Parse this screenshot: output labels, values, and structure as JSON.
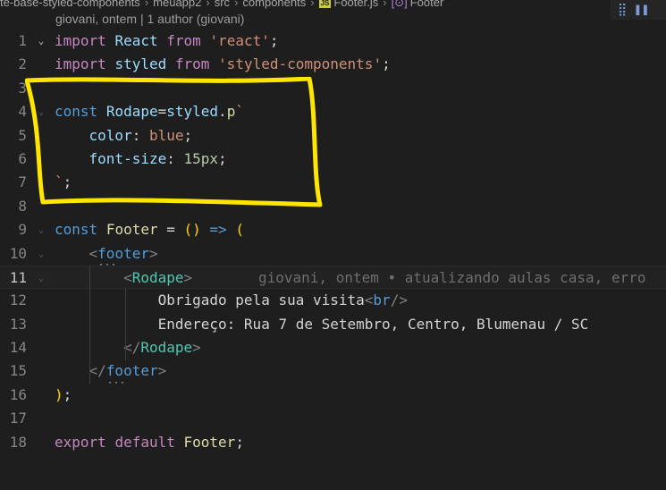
{
  "breadcrumb": {
    "parts": [
      "te-base-styled-components",
      "meuapp2",
      "src",
      "components",
      "Footer.js",
      "Footer"
    ],
    "js_badge": "JS",
    "symbol_badge": "[⊙]"
  },
  "blame_header": "giovani, ontem | 1 author (giovani)",
  "toolbar": {
    "icons": [
      "split-editor-icon",
      "pause-icon"
    ]
  },
  "inline_blame": "giovani, ontem • atualizando aulas casa, erro",
  "lines": [
    {
      "n": "1",
      "tokens": [
        [
          "imp",
          "import"
        ],
        [
          "text",
          " "
        ],
        [
          "var",
          "React"
        ],
        [
          "text",
          " "
        ],
        [
          "imp",
          "from"
        ],
        [
          "text",
          " "
        ],
        [
          "str",
          "'react'"
        ],
        [
          "text",
          ";"
        ]
      ]
    },
    {
      "n": "2",
      "tokens": [
        [
          "imp",
          "import"
        ],
        [
          "text",
          " "
        ],
        [
          "var",
          "styled"
        ],
        [
          "text",
          " "
        ],
        [
          "imp",
          "from"
        ],
        [
          "text",
          " "
        ],
        [
          "str",
          "'styled-components'"
        ],
        [
          "text",
          ";"
        ]
      ]
    },
    {
      "n": "3",
      "tokens": []
    },
    {
      "n": "4",
      "tokens": [
        [
          "kw",
          "const"
        ],
        [
          "text",
          " "
        ],
        [
          "var",
          "Rodape"
        ],
        [
          "text",
          "="
        ],
        [
          "var",
          "styled"
        ],
        [
          "text",
          "."
        ],
        [
          "fn",
          "p"
        ],
        [
          "str",
          "`"
        ]
      ]
    },
    {
      "n": "5",
      "tokens": [
        [
          "text",
          "    "
        ],
        [
          "prop",
          "color"
        ],
        [
          "text",
          ": "
        ],
        [
          "str",
          "blue"
        ],
        [
          "text",
          ";"
        ]
      ]
    },
    {
      "n": "6",
      "tokens": [
        [
          "text",
          "    "
        ],
        [
          "prop",
          "font-size"
        ],
        [
          "text",
          ": "
        ],
        [
          "num",
          "15px"
        ],
        [
          "text",
          ";"
        ]
      ]
    },
    {
      "n": "7",
      "tokens": [
        [
          "str",
          "`"
        ],
        [
          "text",
          ";"
        ]
      ]
    },
    {
      "n": "8",
      "tokens": []
    },
    {
      "n": "9",
      "tokens": [
        [
          "kw",
          "const"
        ],
        [
          "text",
          " "
        ],
        [
          "fn",
          "Footer"
        ],
        [
          "text",
          " = "
        ],
        [
          "brace",
          "()"
        ],
        [
          "text",
          " "
        ],
        [
          "kw",
          "=>"
        ],
        [
          "text",
          " "
        ],
        [
          "brace",
          "("
        ]
      ]
    },
    {
      "n": "10",
      "tokens": [
        [
          "text",
          "    "
        ],
        [
          "punct",
          "<"
        ],
        [
          "tag",
          "footer"
        ],
        [
          "punct",
          ">"
        ]
      ]
    },
    {
      "n": "11",
      "tokens": [
        [
          "text",
          "        "
        ],
        [
          "punct",
          "<"
        ],
        [
          "comp",
          "Rodape"
        ],
        [
          "punct",
          ">"
        ]
      ]
    },
    {
      "n": "12",
      "tokens": [
        [
          "text",
          "            "
        ],
        [
          "text",
          "Obrigado pela sua visita"
        ],
        [
          "punct",
          "<"
        ],
        [
          "tag",
          "br"
        ],
        [
          "punct",
          "/>"
        ]
      ]
    },
    {
      "n": "13",
      "tokens": [
        [
          "text",
          "            "
        ],
        [
          "text",
          "Endereço: Rua 7 de Setembro, Centro, Blumenau / SC"
        ]
      ]
    },
    {
      "n": "14",
      "tokens": [
        [
          "text",
          "        "
        ],
        [
          "punct",
          "</"
        ],
        [
          "comp",
          "Rodape"
        ],
        [
          "punct",
          ">"
        ]
      ]
    },
    {
      "n": "15",
      "tokens": [
        [
          "text",
          "    "
        ],
        [
          "punct",
          "</"
        ],
        [
          "tag",
          "footer"
        ],
        [
          "punct",
          ">"
        ]
      ]
    },
    {
      "n": "16",
      "tokens": [
        [
          "brace",
          ")"
        ],
        [
          "text",
          ";"
        ]
      ]
    },
    {
      "n": "17",
      "tokens": []
    },
    {
      "n": "18",
      "tokens": [
        [
          "imp",
          "export"
        ],
        [
          "text",
          " "
        ],
        [
          "imp",
          "default"
        ],
        [
          "text",
          " "
        ],
        [
          "fn",
          "Footer"
        ],
        [
          "text",
          ";"
        ]
      ]
    }
  ],
  "folds": {
    "1": "bright",
    "4": "dim",
    "9": "dim",
    "10": "dim",
    "11": "dim"
  },
  "active_line": "11",
  "colors": {
    "background": "#1e1e1e",
    "annotation": "#ffe600"
  }
}
